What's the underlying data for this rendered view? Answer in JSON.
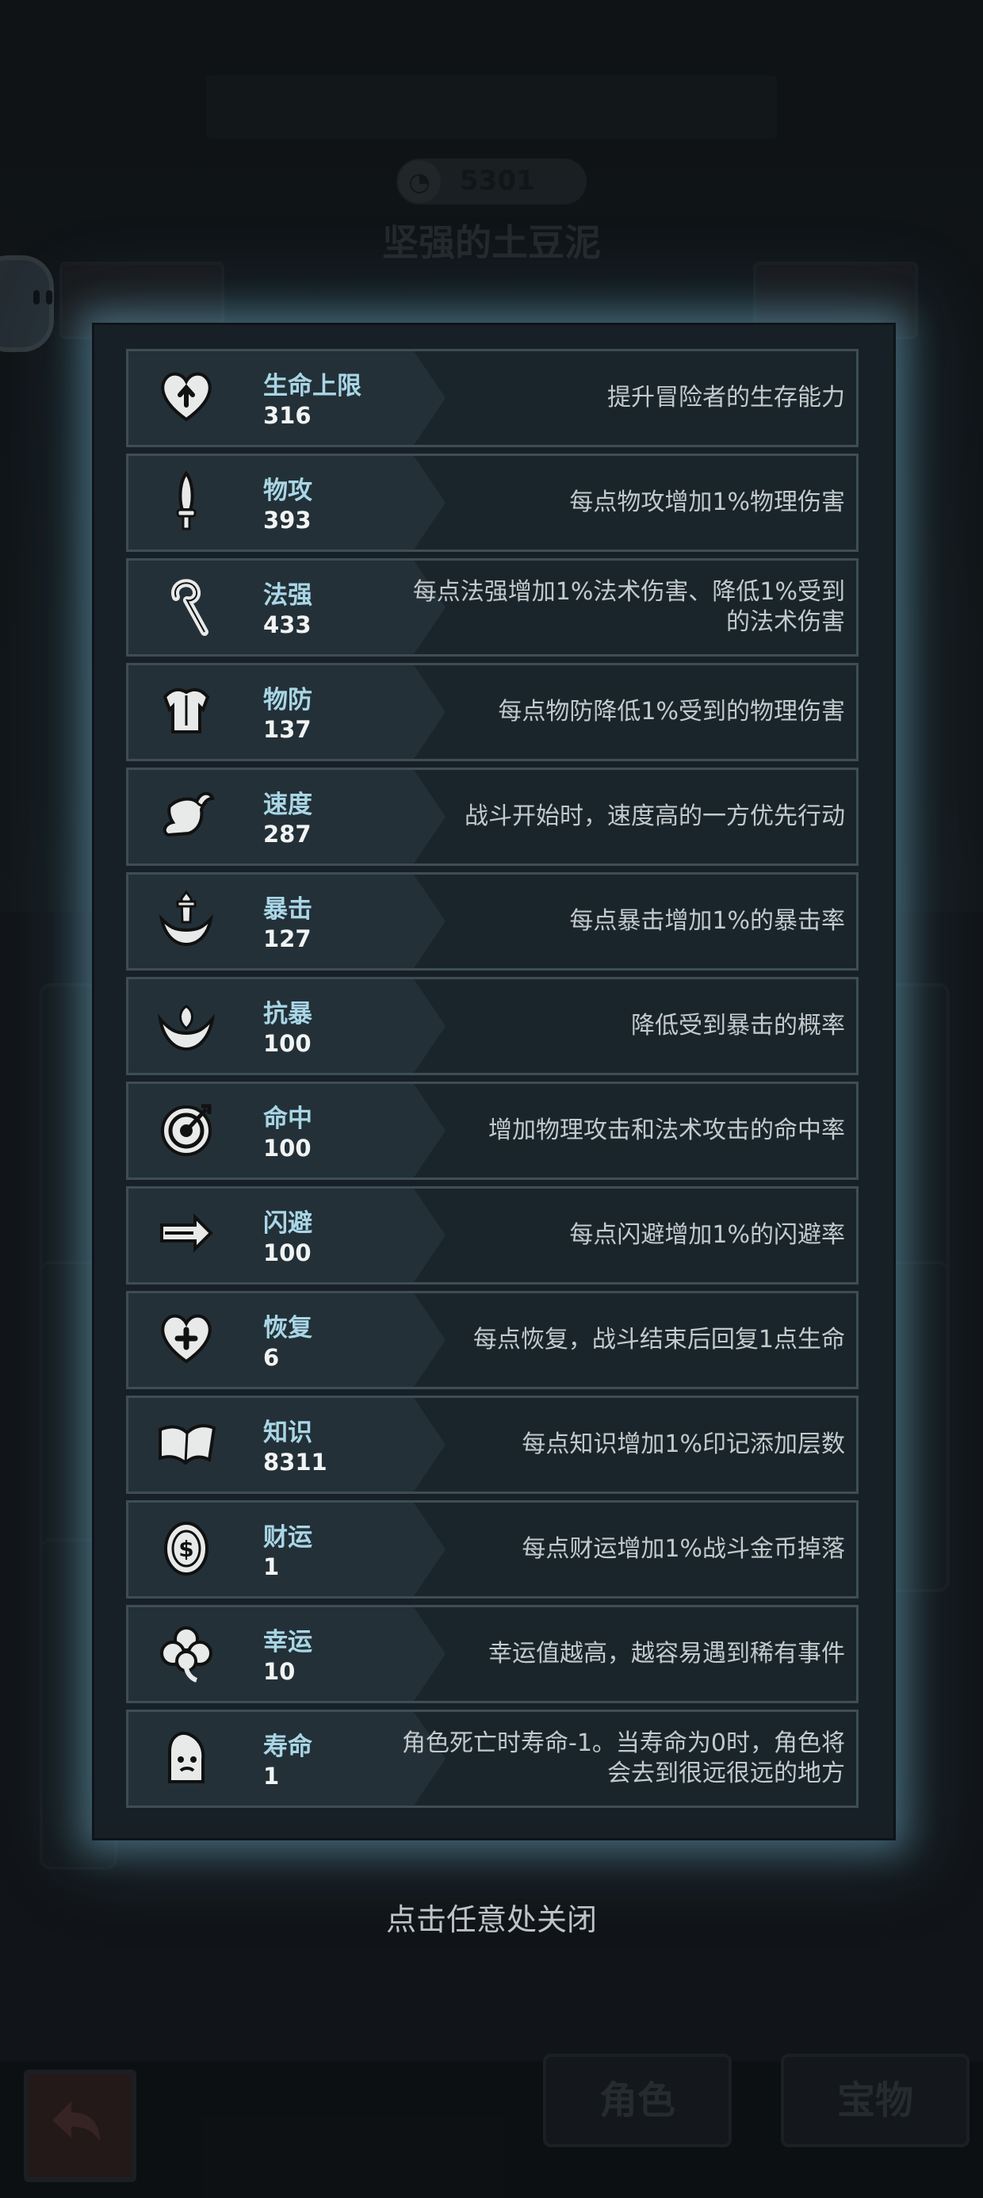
{
  "background": {
    "score": "5301",
    "player_name": "坚强的土豆泥",
    "nav_role": "角色",
    "nav_treasure": "宝物"
  },
  "stats": [
    {
      "name": "生命上限",
      "value": "316",
      "desc": [
        "提升冒险者的生存能力"
      ],
      "icon": "heart-up-icon"
    },
    {
      "name": "物攻",
      "value": "393",
      "desc": [
        "每点物攻增加1%物理伤害"
      ],
      "icon": "sword-icon"
    },
    {
      "name": "法强",
      "value": "433",
      "desc": [
        "每点法强增加1%法术伤害、降低1%受到",
        "的法术伤害"
      ],
      "icon": "staff-icon"
    },
    {
      "name": "物防",
      "value": "137",
      "desc": [
        "每点物防降低1%受到的物理伤害"
      ],
      "icon": "armor-icon"
    },
    {
      "name": "速度",
      "value": "287",
      "desc": [
        "战斗开始时，速度高的一方优先行动"
      ],
      "icon": "winged-boot-icon"
    },
    {
      "name": "暴击",
      "value": "127",
      "desc": [
        "每点暴击增加1%的暴击率"
      ],
      "icon": "crit-sword-icon"
    },
    {
      "name": "抗暴",
      "value": "100",
      "desc": [
        "降低受到暴击的概率"
      ],
      "icon": "crit-resist-icon"
    },
    {
      "name": "命中",
      "value": "100",
      "desc": [
        "增加物理攻击和法术攻击的命中率"
      ],
      "icon": "target-icon"
    },
    {
      "name": "闪避",
      "value": "100",
      "desc": [
        "每点闪避增加1%的闪避率"
      ],
      "icon": "dodge-arrows-icon"
    },
    {
      "name": "恢复",
      "value": "6",
      "desc": [
        "每点恢复，战斗结束后回复1点生命"
      ],
      "icon": "heart-plus-icon"
    },
    {
      "name": "知识",
      "value": "8311",
      "desc": [
        "每点知识增加1%印记添加层数"
      ],
      "icon": "book-icon"
    },
    {
      "name": "财运",
      "value": "1",
      "desc": [
        "每点财运增加1%战斗金币掉落"
      ],
      "icon": "coin-icon"
    },
    {
      "name": "幸运",
      "value": "10",
      "desc": [
        "幸运值越高，越容易遇到稀有事件"
      ],
      "icon": "clover-icon"
    },
    {
      "name": "寿命",
      "value": "1",
      "desc": [
        "角色死亡时寿命-1。当寿命为0时，角色将",
        "会去到很远很远的地方"
      ],
      "icon": "tombstone-icon"
    }
  ],
  "close_hint": "点击任意处关闭",
  "colors": {
    "stat_name": "#a9d6e6",
    "modal_glow": "#6eaac3"
  }
}
